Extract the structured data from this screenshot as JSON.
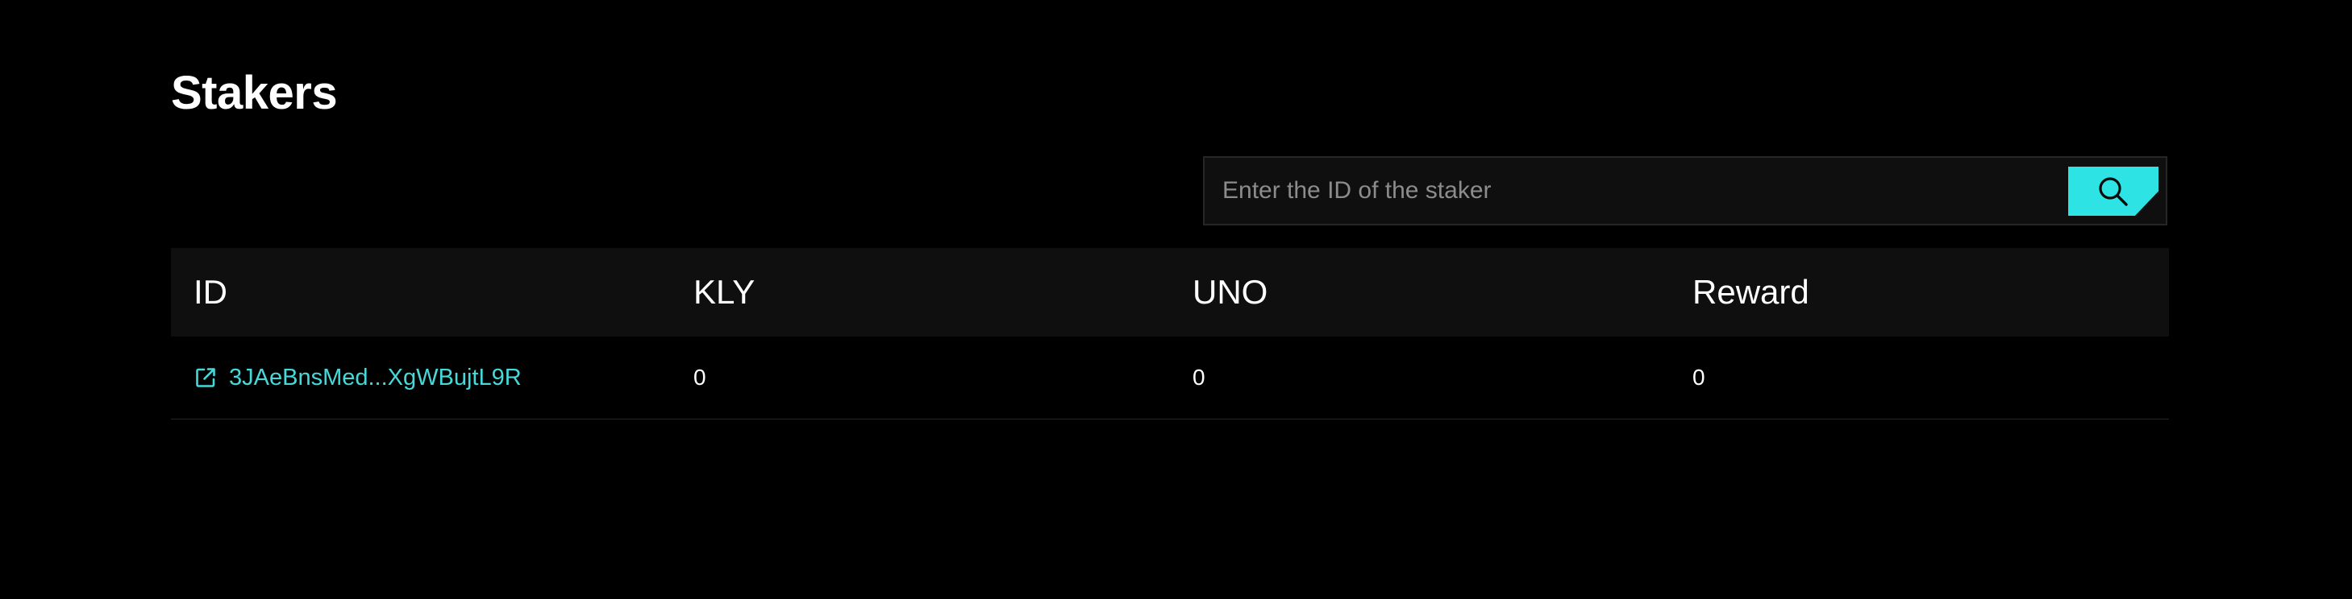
{
  "page": {
    "title": "Stakers"
  },
  "search": {
    "placeholder": "Enter the ID of the staker",
    "value": "",
    "button_icon": "search-icon"
  },
  "table": {
    "columns": [
      "ID",
      "KLY",
      "UNO",
      "Reward"
    ],
    "rows": [
      {
        "id": "3JAeBnsMed...XgWBujtL9R",
        "id_icon": "external-link-icon",
        "kly": "0",
        "uno": "0",
        "reward": "0"
      }
    ]
  },
  "colors": {
    "background": "#000000",
    "surface": "#0f0f0f",
    "accent": "#2ee3e3",
    "link": "#46d9d9",
    "border": "#262626"
  }
}
